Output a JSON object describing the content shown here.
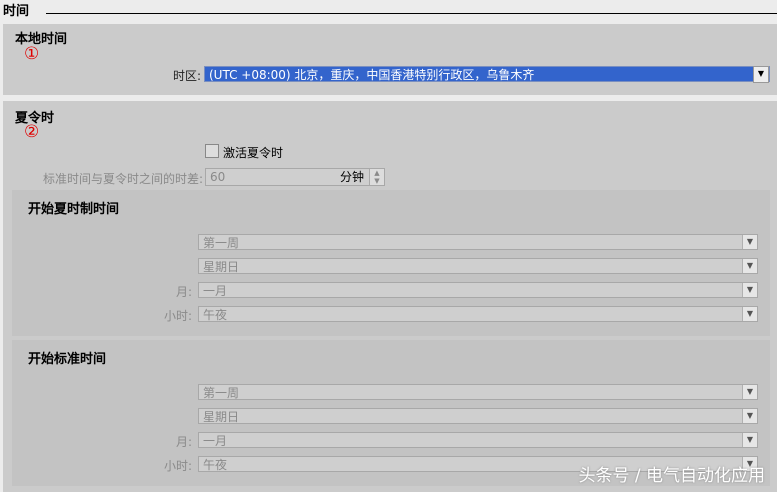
{
  "header": {
    "title": "时间"
  },
  "local_time": {
    "title": "本地时间",
    "marker": "①",
    "timezone_label": "时区:",
    "timezone_value": "(UTC +08:00) 北京，重庆，中国香港特别行政区，乌鲁木齐"
  },
  "dst": {
    "title": "夏令时",
    "marker": "②",
    "activate_label": "激活夏令时",
    "activate_checked": false,
    "offset_label": "标准时间与夏令时之间的时差:",
    "offset_value": "60",
    "offset_unit": "分钟",
    "start_dst": {
      "title": "开始夏时制时间",
      "week": "第一周",
      "weekday": "星期日",
      "month_label": "月:",
      "month": "一月",
      "hour_label": "小时:",
      "hour": "午夜"
    },
    "start_std": {
      "title": "开始标准时间",
      "week": "第一周",
      "weekday": "星期日",
      "month_label": "月:",
      "month": "一月",
      "hour_label": "小时:",
      "hour": "午夜"
    }
  },
  "watermark": "头条号 / 电气自动化应用"
}
